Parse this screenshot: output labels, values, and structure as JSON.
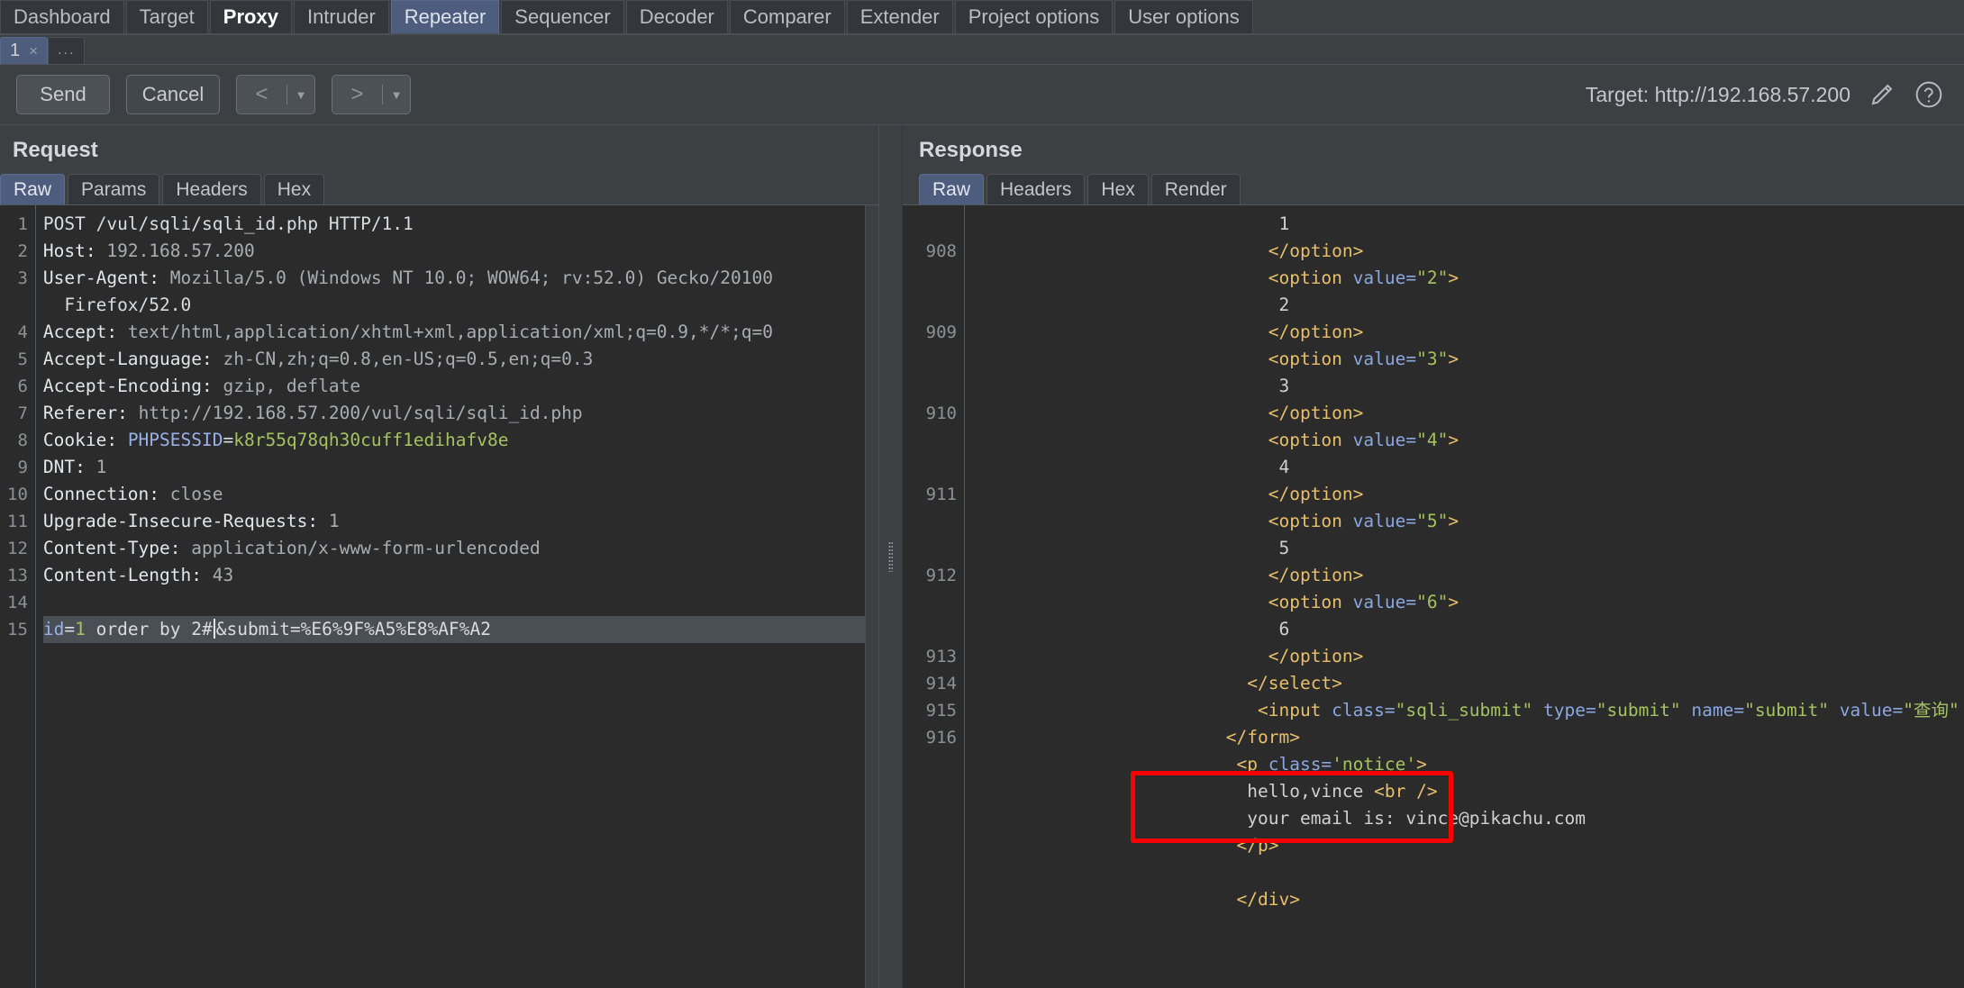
{
  "main_tabs": [
    {
      "label": "Dashboard",
      "state": "normal"
    },
    {
      "label": "Target",
      "state": "normal"
    },
    {
      "label": "Proxy",
      "state": "bold"
    },
    {
      "label": "Intruder",
      "state": "normal"
    },
    {
      "label": "Repeater",
      "state": "active"
    },
    {
      "label": "Sequencer",
      "state": "normal"
    },
    {
      "label": "Decoder",
      "state": "normal"
    },
    {
      "label": "Comparer",
      "state": "normal"
    },
    {
      "label": "Extender",
      "state": "normal"
    },
    {
      "label": "Project options",
      "state": "normal"
    },
    {
      "label": "User options",
      "state": "normal"
    }
  ],
  "repeater_tabs": {
    "items": [
      {
        "label": "1",
        "close": "×",
        "active": true
      }
    ],
    "add_label": "..."
  },
  "toolbar": {
    "send_label": "Send",
    "cancel_label": "Cancel",
    "prev_arrow": "<",
    "next_arrow": ">",
    "caret": "▼",
    "target_label": "Target: http://192.168.57.200",
    "edit_icon": "pencil-icon",
    "help_icon": "question-icon"
  },
  "request": {
    "title": "Request",
    "tabs": [
      {
        "label": "Raw",
        "active": true
      },
      {
        "label": "Params",
        "active": false
      },
      {
        "label": "Headers",
        "active": false
      },
      {
        "label": "Hex",
        "active": false
      }
    ],
    "line_numbers": [
      "1",
      "2",
      "3",
      "",
      "4",
      "5",
      "6",
      "7",
      "8",
      "9",
      "10",
      "11",
      "12",
      "13",
      "14",
      "15"
    ],
    "lines": [
      "POST /vul/sqli/sqli_id.php HTTP/1.1",
      "Host: 192.168.57.200",
      "User-Agent: Mozilla/5.0 (Windows NT 10.0; WOW64; rv:52.0) Gecko/20100",
      "  Firefox/52.0",
      "Accept: text/html,application/xhtml+xml,application/xml;q=0.9,*/*;q=0",
      "Accept-Language: zh-CN,zh;q=0.8,en-US;q=0.5,en;q=0.3",
      "Accept-Encoding: gzip, deflate",
      "Referer: http://192.168.57.200/vul/sqli/sqli_id.php",
      "Cookie: PHPSESSID=k8r55q78qh30cuff1edihafv8e",
      "DNT: 1",
      "Connection: close",
      "Upgrade-Insecure-Requests: 1",
      "Content-Type: application/x-www-form-urlencoded",
      "Content-Length: 43",
      "",
      "id=1 order by 2#&submit=%E6%9F%A5%E8%AF%A2"
    ],
    "highlighted_line_index": 15,
    "body": {
      "param_name": "id",
      "equals": "=",
      "param_value": "1",
      "payload": " order by 2#",
      "rest": "&submit=%E6%9F%A5%E8%AF%A2"
    },
    "cookie": {
      "name": "Cookie: ",
      "key": "PHPSESSID",
      "equals": "=",
      "value": "k8r55q78qh30cuff1edihafv8e"
    }
  },
  "response": {
    "title": "Response",
    "tabs": [
      {
        "label": "Raw",
        "active": true
      },
      {
        "label": "Headers",
        "active": false
      },
      {
        "label": "Hex",
        "active": false
      },
      {
        "label": "Render",
        "active": false
      }
    ],
    "line_numbers": [
      "",
      "908",
      "",
      "",
      "909",
      "",
      "",
      "910",
      "",
      "",
      "911",
      "",
      "",
      "912",
      "",
      "",
      "913",
      "914",
      "915",
      "916",
      "",
      "",
      "",
      ""
    ],
    "lines": [
      {
        "indent": 29,
        "parts": [
          {
            "t": "txt",
            "v": "1"
          }
        ]
      },
      {
        "indent": 28,
        "parts": [
          {
            "t": "tag",
            "v": "</option>"
          }
        ]
      },
      {
        "indent": 28,
        "parts": [
          {
            "t": "tag",
            "v": "<option "
          },
          {
            "t": "attr",
            "v": "value="
          },
          {
            "t": "str",
            "v": "\"2\""
          },
          {
            "t": "tag",
            "v": ">"
          }
        ]
      },
      {
        "indent": 29,
        "parts": [
          {
            "t": "txt",
            "v": "2"
          }
        ]
      },
      {
        "indent": 28,
        "parts": [
          {
            "t": "tag",
            "v": "</option>"
          }
        ]
      },
      {
        "indent": 28,
        "parts": [
          {
            "t": "tag",
            "v": "<option "
          },
          {
            "t": "attr",
            "v": "value="
          },
          {
            "t": "str",
            "v": "\"3\""
          },
          {
            "t": "tag",
            "v": ">"
          }
        ]
      },
      {
        "indent": 29,
        "parts": [
          {
            "t": "txt",
            "v": "3"
          }
        ]
      },
      {
        "indent": 28,
        "parts": [
          {
            "t": "tag",
            "v": "</option>"
          }
        ]
      },
      {
        "indent": 28,
        "parts": [
          {
            "t": "tag",
            "v": "<option "
          },
          {
            "t": "attr",
            "v": "value="
          },
          {
            "t": "str",
            "v": "\"4\""
          },
          {
            "t": "tag",
            "v": ">"
          }
        ]
      },
      {
        "indent": 29,
        "parts": [
          {
            "t": "txt",
            "v": "4"
          }
        ]
      },
      {
        "indent": 28,
        "parts": [
          {
            "t": "tag",
            "v": "</option>"
          }
        ]
      },
      {
        "indent": 28,
        "parts": [
          {
            "t": "tag",
            "v": "<option "
          },
          {
            "t": "attr",
            "v": "value="
          },
          {
            "t": "str",
            "v": "\"5\""
          },
          {
            "t": "tag",
            "v": ">"
          }
        ]
      },
      {
        "indent": 29,
        "parts": [
          {
            "t": "txt",
            "v": "5"
          }
        ]
      },
      {
        "indent": 28,
        "parts": [
          {
            "t": "tag",
            "v": "</option>"
          }
        ]
      },
      {
        "indent": 28,
        "parts": [
          {
            "t": "tag",
            "v": "<option "
          },
          {
            "t": "attr",
            "v": "value="
          },
          {
            "t": "str",
            "v": "\"6\""
          },
          {
            "t": "tag",
            "v": ">"
          }
        ]
      },
      {
        "indent": 29,
        "parts": [
          {
            "t": "txt",
            "v": "6"
          }
        ]
      },
      {
        "indent": 28,
        "parts": [
          {
            "t": "tag",
            "v": "</option>"
          }
        ]
      },
      {
        "indent": 26,
        "parts": [
          {
            "t": "tag",
            "v": "</select>"
          }
        ]
      },
      {
        "indent": 27,
        "parts": [
          {
            "t": "tag",
            "v": "<input "
          },
          {
            "t": "attr",
            "v": "class="
          },
          {
            "t": "str",
            "v": "\"sqli_submit\""
          },
          {
            "t": "txt",
            "v": " "
          },
          {
            "t": "attr",
            "v": "type="
          },
          {
            "t": "str",
            "v": "\"submit\""
          },
          {
            "t": "txt",
            "v": " "
          },
          {
            "t": "attr",
            "v": "name="
          },
          {
            "t": "str",
            "v": "\"submit\""
          },
          {
            "t": "txt",
            "v": " "
          },
          {
            "t": "attr",
            "v": "value="
          },
          {
            "t": "str",
            "v": "\"查询\""
          },
          {
            "t": "tag",
            "v": " /"
          }
        ]
      },
      {
        "indent": 24,
        "parts": [
          {
            "t": "tag",
            "v": "</form>"
          }
        ]
      },
      {
        "indent": 25,
        "parts": [
          {
            "t": "tag",
            "v": "<p "
          },
          {
            "t": "attr",
            "v": "class="
          },
          {
            "t": "str",
            "v": "'notice'"
          },
          {
            "t": "tag",
            "v": ">"
          }
        ]
      },
      {
        "indent": 26,
        "parts": [
          {
            "t": "txt",
            "v": "hello,vince "
          },
          {
            "t": "tag",
            "v": "<br"
          },
          {
            "t": "txt",
            "v": " "
          },
          {
            "t": "tag",
            "v": "/>"
          }
        ]
      },
      {
        "indent": 26,
        "parts": [
          {
            "t": "txt",
            "v": "your email is: vince@pikachu.com"
          }
        ]
      },
      {
        "indent": 25,
        "parts": [
          {
            "t": "tag",
            "v": "</p>"
          }
        ]
      },
      {
        "indent": 25,
        "parts": [
          {
            "t": "txt",
            "v": ""
          }
        ]
      },
      {
        "indent": 25,
        "parts": [
          {
            "t": "tag",
            "v": "</div>"
          }
        ]
      }
    ],
    "annotation": {
      "color": "#ff0000",
      "text_line_1": "hello,vince <br />",
      "text_line_2": "your email is: vince@pikachu.com"
    }
  }
}
